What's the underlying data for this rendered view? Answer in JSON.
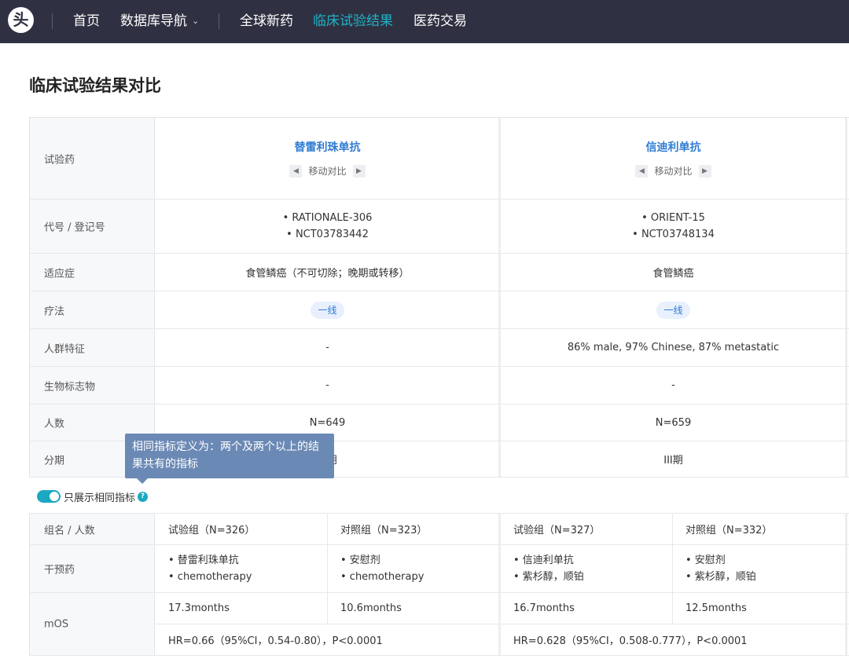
{
  "nav": {
    "logo_glyph": "头",
    "items": [
      {
        "label": "首页",
        "active": false
      },
      {
        "label": "数据库导航",
        "active": false
      },
      {
        "label": "全球新药",
        "active": false
      },
      {
        "label": "临床试验结果",
        "active": true
      },
      {
        "label": "医药交易",
        "active": false
      }
    ],
    "dropdown_icon": "chevron-down-icon",
    "active_color": "#1fb3c6"
  },
  "page": {
    "title": "临床试验结果对比"
  },
  "rows": {
    "drug": {
      "label": "试验药"
    },
    "code": {
      "label": "代号 / 登记号"
    },
    "indication": {
      "label": "适应症"
    },
    "therapy": {
      "label": "疗法"
    },
    "population": {
      "label": "人群特征"
    },
    "biomarker": {
      "label": "生物标志物"
    },
    "count": {
      "label": "人数"
    },
    "phase": {
      "label": "分期"
    }
  },
  "move_label": "移动对比",
  "trials": [
    {
      "drug": "替雷利珠单抗",
      "codes": [
        "• RATIONALE-306",
        "• NCT03783442"
      ],
      "indication": "食管鳞癌（不可切除；晚期或转移）",
      "therapy": "一线",
      "population": "-",
      "biomarker": "-",
      "count": "N=649",
      "phase": "III期",
      "groups": [
        {
          "name": "试验组（N=326）",
          "drugs": [
            "• 替雷利珠单抗",
            "• chemotherapy"
          ],
          "mos": "17.3months"
        },
        {
          "name": "对照组（N=323）",
          "drugs": [
            "• 安慰剂",
            "• chemotherapy"
          ],
          "mos": "10.6months"
        }
      ],
      "hr": "HR=0.66（95%CI，0.54-0.80），P<0.0001"
    },
    {
      "drug": "信迪利单抗",
      "codes": [
        "• ORIENT-15",
        "• NCT03748134"
      ],
      "indication": "食管鳞癌",
      "therapy": "一线",
      "population": "86% male, 97% Chinese, 87% metastatic",
      "biomarker": "-",
      "count": "N=659",
      "phase": "III期",
      "groups": [
        {
          "name": "试验组（N=327）",
          "drugs": [
            "• 信迪利单抗",
            "• 紫杉醇，顺铂"
          ],
          "mos": "16.7months"
        },
        {
          "name": "对照组（N=332）",
          "drugs": [
            "• 安慰剂",
            "• 紫杉醇，顺铂"
          ],
          "mos": "12.5months"
        }
      ],
      "hr": "HR=0.628（95%CI，0.508-0.777），P<0.0001"
    }
  ],
  "toggle": {
    "label": "只展示相同指标",
    "on": true,
    "help_icon": "help-icon",
    "help_glyph": "?"
  },
  "group_row": {
    "label": "组名 / 人数"
  },
  "intervention_row": {
    "label": "干预药"
  },
  "mos_row": {
    "label": "mOS"
  },
  "tooltip": {
    "text": "相同指标定义为：两个及两个以上的结果共有的指标"
  },
  "colors": {
    "nav_bg": "#2f3142",
    "accent": "#1aa8c3",
    "link": "#2f7bd4",
    "tooltip_bg": "#6b89b5"
  }
}
